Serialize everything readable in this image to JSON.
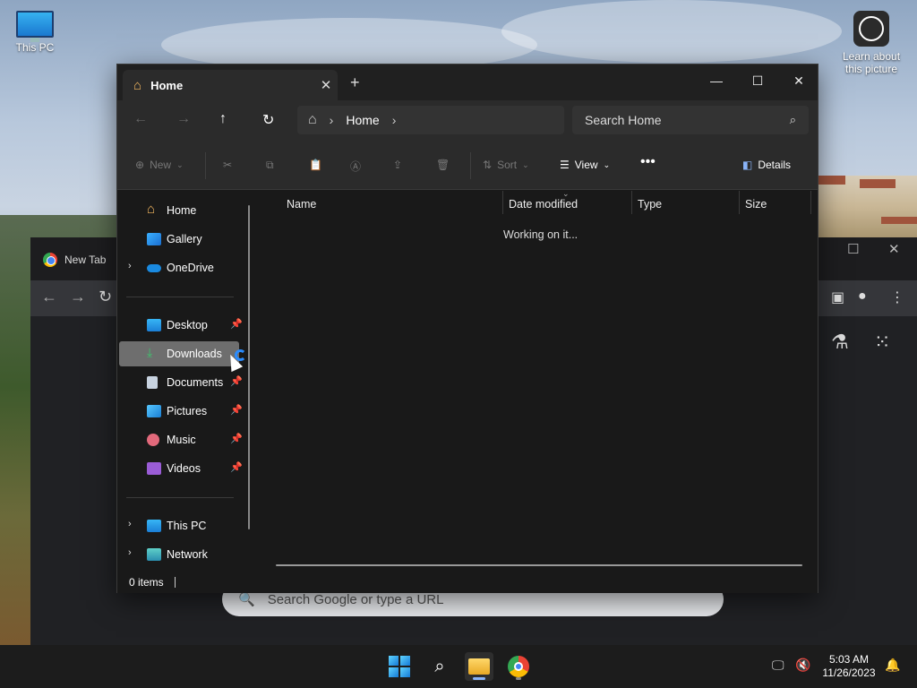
{
  "desktop": {
    "this_pc_label": "This PC",
    "learn_label_line1": "Learn about",
    "learn_label_line2": "this picture"
  },
  "chrome": {
    "tab_title": "New Tab",
    "omnibox_placeholder": "Search Google or type a URL"
  },
  "explorer": {
    "tab_title": "Home",
    "address": {
      "crumb": "Home"
    },
    "search_placeholder": "Search Home",
    "commands": {
      "new": "New",
      "sort": "Sort",
      "view": "View",
      "details": "Details"
    },
    "nav": [
      {
        "label": "Home"
      },
      {
        "label": "Gallery"
      },
      {
        "label": "OneDrive"
      },
      {
        "label": "Desktop"
      },
      {
        "label": "Downloads"
      },
      {
        "label": "Documents"
      },
      {
        "label": "Pictures"
      },
      {
        "label": "Music"
      },
      {
        "label": "Videos"
      },
      {
        "label": "This PC"
      },
      {
        "label": "Network"
      }
    ],
    "columns": [
      "Name",
      "Date modified",
      "Type",
      "Size"
    ],
    "working_text": "Working on it...",
    "status_items": "0 items"
  },
  "taskbar": {
    "time": "5:03 AM",
    "date": "11/26/2023"
  },
  "icons": [
    "home-icon",
    "gallery-icon",
    "onedrive-icon",
    "desktop-icon",
    "downloads-icon",
    "documents-icon",
    "pictures-icon",
    "music-icon",
    "videos-icon",
    "this-pc-icon",
    "network-icon",
    "pin-icon",
    "search-icon",
    "refresh-icon",
    "up-arrow-icon"
  ],
  "colors": {
    "accent": "#2a8cff",
    "window_bg": "#191919",
    "toolbar_bg": "#2b2b2b",
    "selected_nav": "#6e6e6e"
  }
}
